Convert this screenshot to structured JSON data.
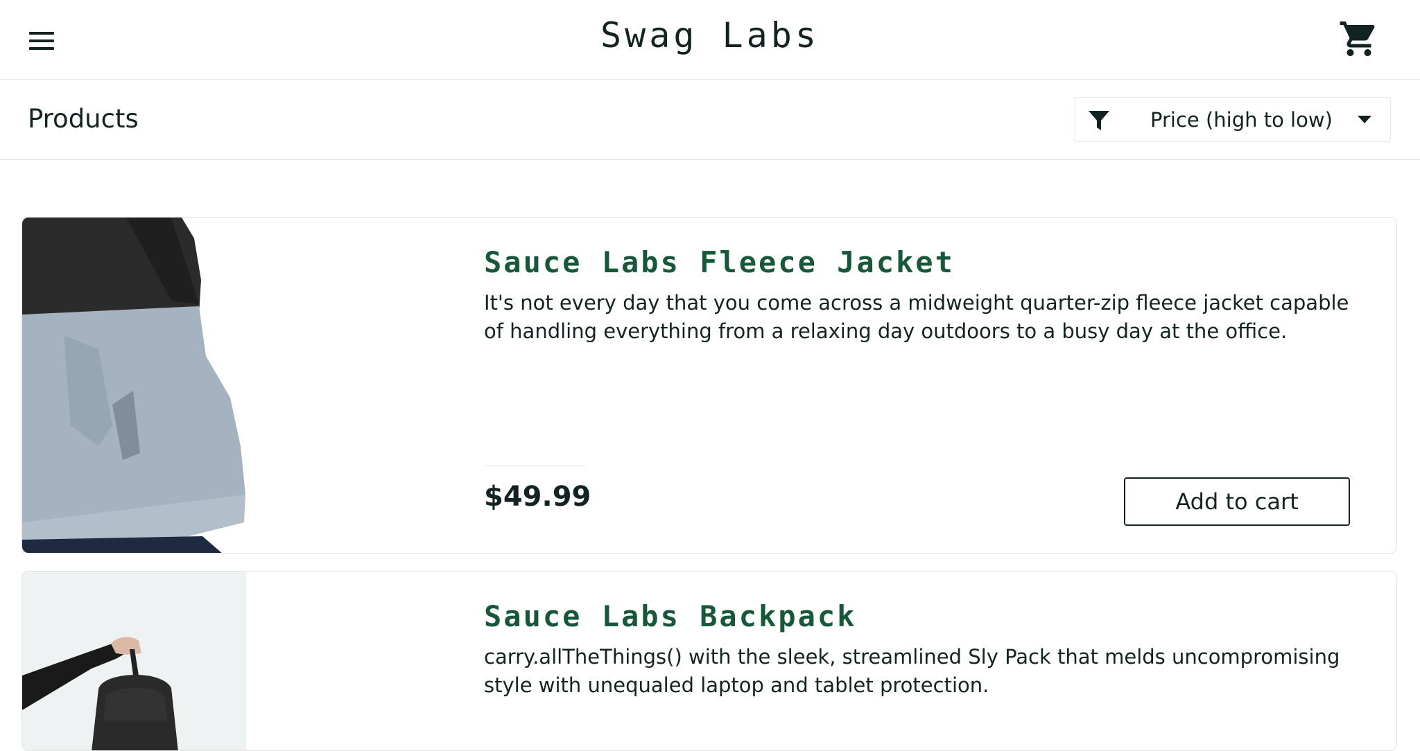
{
  "header": {
    "menu_icon": "hamburger-menu-icon",
    "logo": "Swag Labs",
    "cart_icon": "shopping-cart-icon"
  },
  "sub_header": {
    "title": "Products",
    "sort": {
      "icon": "filter-icon",
      "selected": "Price (high to low)",
      "caret_icon": "caret-down-icon"
    }
  },
  "colors": {
    "text": "#132322",
    "item_name": "#18583a",
    "border": "#e3e3e3"
  },
  "items": [
    {
      "name": "Sauce Labs Fleece Jacket",
      "description": "It's not every day that you come across a midweight quarter-zip fleece jacket capable of handling everything from a relaxing day outdoors to a busy day at the office.",
      "price": "$49.99",
      "button": "Add to cart"
    },
    {
      "name": "Sauce Labs Backpack",
      "description": "carry.allTheThings() with the sleek, streamlined Sly Pack that melds uncompromising style with unequaled laptop and tablet protection."
    }
  ]
}
